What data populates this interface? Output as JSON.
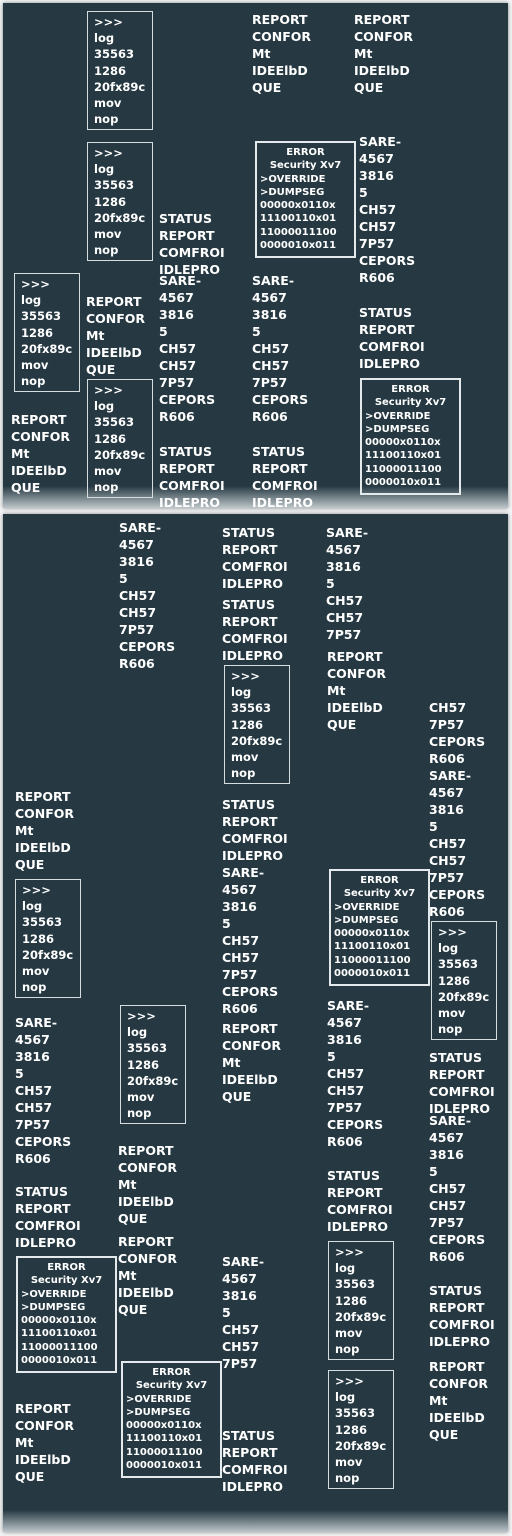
{
  "blocks": {
    "log": [
      ">>>",
      "log",
      "35563",
      "1286",
      "20fx89c",
      "mov",
      "nop"
    ],
    "report": [
      "REPORT",
      "CONFOR",
      "Mt",
      "IDEElbD",
      "QUE"
    ],
    "status": [
      "STATUS",
      "REPORT",
      "COMFROI",
      "IDLEPRO"
    ],
    "sare": [
      "SARE-",
      "4567",
      "3816",
      "5",
      "CH57",
      "CH57",
      "7P57",
      "CEPORS",
      "R606"
    ],
    "sare_short": [
      "SARE-",
      "4567",
      "3816",
      "5",
      "CH57",
      "CH57",
      "7P57"
    ],
    "ch": [
      "CH57",
      "7P57",
      "CEPORS",
      "R606"
    ],
    "error": [
      "ERROR",
      "Security Xv7",
      ">OVERRIDE",
      ">DUMPSEG",
      "00000x0110x",
      "11100110x01",
      "11000011100",
      "0000010x011"
    ]
  }
}
